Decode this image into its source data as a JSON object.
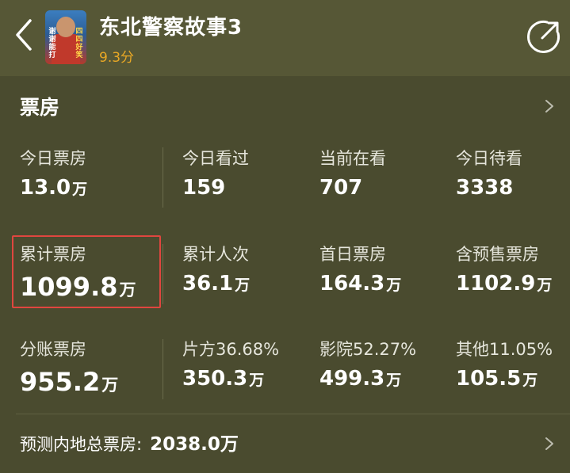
{
  "header": {
    "title": "东北警察故事3",
    "score": "9.3分",
    "poster_text_left": "谢谢能打",
    "poster_text_right": "四四好笑"
  },
  "box_office": {
    "section_title": "票房",
    "rows": [
      [
        {
          "label": "今日票房",
          "value": "13.0",
          "unit": "万"
        },
        {
          "label": "今日看过",
          "value": "159",
          "unit": ""
        },
        {
          "label": "当前在看",
          "value": "707",
          "unit": ""
        },
        {
          "label": "今日待看",
          "value": "3338",
          "unit": ""
        }
      ],
      [
        {
          "label": "累计票房",
          "value": "1099.8",
          "unit": "万"
        },
        {
          "label": "累计人次",
          "value": "36.1",
          "unit": "万"
        },
        {
          "label": "首日票房",
          "value": "164.3",
          "unit": "万"
        },
        {
          "label": "含预售票房",
          "value": "1102.9",
          "unit": "万"
        }
      ],
      [
        {
          "label": "分账票房",
          "value": "955.2",
          "unit": "万"
        },
        {
          "label": "片方36.68%",
          "value": "350.3",
          "unit": "万"
        },
        {
          "label": "影院52.27%",
          "value": "499.3",
          "unit": "万"
        },
        {
          "label": "其他11.05%",
          "value": "105.5",
          "unit": "万"
        }
      ]
    ]
  },
  "forecast": {
    "label": "预测内地总票房:",
    "value": "2038.0万"
  },
  "colors": {
    "background": "#4a4b2f",
    "header": "#565736",
    "score": "#e9a825",
    "highlight": "#e0463f"
  },
  "icons": [
    "back-arrow-icon",
    "share-icon",
    "chevron-right-icon"
  ]
}
